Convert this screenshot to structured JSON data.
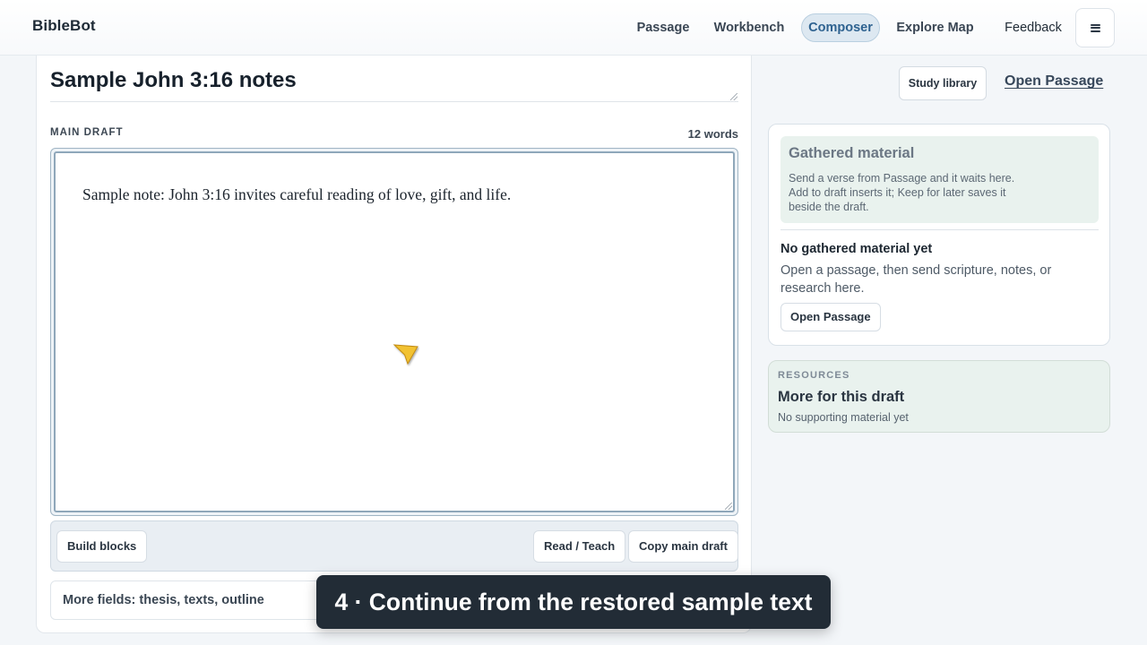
{
  "app": {
    "brand": "BibleBot"
  },
  "nav": {
    "items": [
      {
        "label": "Passage",
        "active": false
      },
      {
        "label": "Workbench",
        "active": false
      },
      {
        "label": "Composer",
        "active": true
      },
      {
        "label": "Explore Map",
        "active": false
      },
      {
        "label": "Feedback",
        "active": false
      }
    ],
    "menu_icon": "hamburger-icon"
  },
  "editor": {
    "title": "Sample John 3:16 notes",
    "section_label": "MAIN DRAFT",
    "word_count": "12 words",
    "draft_text": "Sample note: John 3:16 invites careful reading of love, gift, and life.",
    "actions": {
      "build_blocks": "Build blocks",
      "read_teach": "Read / Teach",
      "copy_main_draft": "Copy main draft"
    },
    "more_fields": "More fields: thesis, texts, outline"
  },
  "sidebar": {
    "study_library": "Study library",
    "open_passage_link": "Open Passage",
    "gathered": {
      "title": "Gathered material",
      "description": "Send a verse from Passage and it waits here. Add to draft inserts it; Keep for later saves it beside the draft.",
      "empty_title": "No gathered material yet",
      "empty_description": "Open a passage, then send scripture, notes, or research here.",
      "open_passage_button": "Open Passage"
    },
    "resources": {
      "label": "RESOURCES",
      "title": "More for this draft",
      "subtitle": "No supporting material yet"
    }
  },
  "caption": "4 · Continue from the restored sample text",
  "colors": {
    "accent": "#2e6290",
    "active_nav_bg": "#dde8f1",
    "panel_green": "#e9f2ee",
    "caption_bg": "#222c36",
    "cursor": "#f2c230"
  }
}
